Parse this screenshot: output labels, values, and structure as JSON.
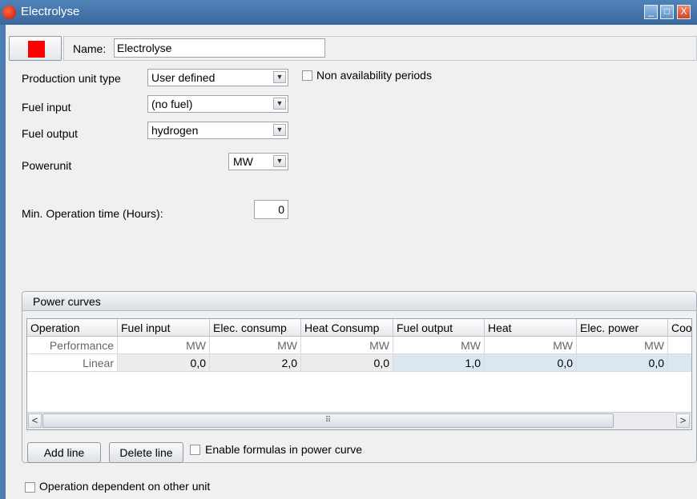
{
  "window": {
    "title": "Electrolyse",
    "min": "_",
    "max": "□",
    "close": "X"
  },
  "unit_color": "#ff0000",
  "name": {
    "label": "Name:",
    "value": "Electrolyse"
  },
  "production_unit_type": {
    "label": "Production unit type",
    "value": "User defined"
  },
  "non_availability": {
    "label": "Non availability periods"
  },
  "fuel_input": {
    "label": "Fuel input",
    "value": "(no fuel)"
  },
  "fuel_output": {
    "label": "Fuel output",
    "value": "hydrogen"
  },
  "powerunit": {
    "label": "Powerunit",
    "value": "MW"
  },
  "min_operation": {
    "label": "Min. Operation time (Hours):",
    "value": "0"
  },
  "power_curves": {
    "title": "Power curves",
    "columns": [
      "Operation",
      "Fuel input",
      "Elec. consump",
      "Heat Consump",
      "Fuel output",
      "Heat",
      "Elec. power",
      "Coo"
    ],
    "rows": [
      [
        "Performance",
        "MW",
        "MW",
        "MW",
        "MW",
        "MW",
        "MW",
        ""
      ],
      [
        "Linear",
        "0,0",
        "2,0",
        "0,0",
        "1,0",
        "0,0",
        "0,0",
        ""
      ]
    ],
    "scroll_left": "<",
    "scroll_right": ">",
    "scroll_grip": "⠿"
  },
  "buttons": {
    "add_line": "Add line",
    "delete_line": "Delete line"
  },
  "enable_formulas": {
    "label": "Enable formulas in power curve"
  },
  "operation_dependent": {
    "label": "Operation dependent on other unit"
  }
}
